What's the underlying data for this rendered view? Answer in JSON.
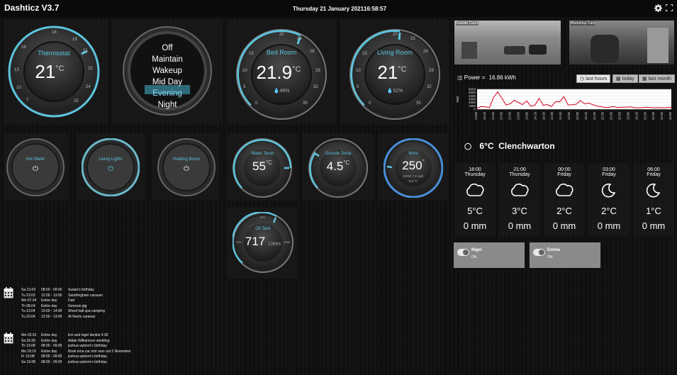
{
  "header": {
    "title": "Dashticz V3.7",
    "date": "Thursday 21 January 2021",
    "time": "16:58:57"
  },
  "thermostat": {
    "label": "Thermostat",
    "value": "21",
    "unit": "°C",
    "ticks": [
      "5",
      "7",
      "10",
      "13",
      "16",
      "18",
      "19",
      "20",
      "21",
      "22",
      "24",
      "25"
    ]
  },
  "mode_selector": {
    "items": [
      "Off",
      "Maintain",
      "Wakeup",
      "Mid Day",
      "Evening",
      "Night"
    ],
    "selected": "Evening"
  },
  "bedroom": {
    "label": "Bed Room",
    "value": "21.9",
    "unit": "°C",
    "humidity": "49%",
    "ticks": [
      "0",
      "5",
      "10",
      "15",
      "20",
      "23",
      "26",
      "29",
      "32",
      "35"
    ]
  },
  "livingroom": {
    "label": "Living Room",
    "value": "21",
    "unit": "°C",
    "humidity": "52%",
    "ticks": [
      "0",
      "5",
      "10",
      "15",
      "20",
      "23",
      "26",
      "29",
      "32",
      "35"
    ]
  },
  "switches": [
    {
      "label": "Hot Water"
    },
    {
      "label": "Living Lights"
    },
    {
      "label": "Heating Boost"
    }
  ],
  "water_temp": {
    "label": "Water Temp",
    "value": "55",
    "unit": "°C"
  },
  "outside_temp": {
    "label": "Outside Temp",
    "value": "4.5",
    "unit": "°C"
  },
  "wind": {
    "label": "Wind",
    "value": "250",
    "unit": "°",
    "sub1": "WSW",
    "sub2": "7.3 mph",
    "sub3": "5.8 °C"
  },
  "oil_tank": {
    "label": "Oil Tank",
    "value": "717",
    "unit": "Litres",
    "ticks": [
      "0",
      "125",
      "250",
      "375",
      "500",
      "625",
      "750",
      "875",
      "1000",
      "1125",
      "1250"
    ]
  },
  "cameras": [
    {
      "caption": "Outside Cam1"
    },
    {
      "caption": "Workshop Cam"
    }
  ],
  "power": {
    "label": "Power",
    "value": "16.86 kWh",
    "buttons": {
      "last_hours": "last hours",
      "today": "today",
      "last_month": "last month"
    },
    "ylabel": "Watt",
    "yticks": [
      "0",
      "1000",
      "2000",
      "3000",
      "4000",
      "5000",
      "6000"
    ],
    "xticks": [
      "13:00",
      "13:10",
      "13:20",
      "13:30",
      "13:40",
      "13:50",
      "14:00",
      "14:10",
      "14:20",
      "14:30",
      "14:40",
      "14:50",
      "15:00",
      "15:10",
      "15:20",
      "15:30",
      "15:40",
      "15:50",
      "16:00",
      "16:10",
      "16:20",
      "16:30",
      "16:40",
      "16:50"
    ]
  },
  "chart_data": {
    "type": "line",
    "title": "",
    "xlabel": "",
    "ylabel": "Watt",
    "ylim": [
      0,
      6000
    ],
    "x": [
      "13:00",
      "13:05",
      "13:10",
      "13:15",
      "13:20",
      "13:25",
      "13:30",
      "13:35",
      "13:40",
      "13:45",
      "13:50",
      "13:55",
      "14:00",
      "14:05",
      "14:10",
      "14:15",
      "14:20",
      "14:25",
      "14:30",
      "14:35",
      "14:40",
      "14:45",
      "14:50",
      "14:55",
      "15:00",
      "15:05",
      "15:10",
      "15:15",
      "15:20",
      "15:25",
      "15:30",
      "15:35",
      "15:40",
      "15:45",
      "15:50",
      "15:55",
      "16:00",
      "16:05",
      "16:10",
      "16:15",
      "16:20",
      "16:25",
      "16:30",
      "16:35",
      "16:40",
      "16:45",
      "16:50",
      "16:55"
    ],
    "series": [
      {
        "color": "#d0021b",
        "values": [
          300,
          800,
          700,
          500,
          3600,
          5200,
          3300,
          1300,
          1600,
          2700,
          2000,
          1400,
          2500,
          900,
          1200,
          3300,
          1200,
          1400,
          800,
          2300,
          2200,
          3800,
          1300,
          1300,
          1500,
          2600,
          1600,
          1800,
          1400,
          900,
          800,
          500,
          600,
          800,
          500,
          600,
          600,
          700,
          500,
          400,
          500,
          600,
          500,
          400,
          500,
          400,
          500,
          600
        ]
      }
    ]
  },
  "weather": {
    "current": "6°C  Clenchwarton",
    "forecast": [
      {
        "time": "18:00",
        "day": "Thursday",
        "icon": "cloud-icon",
        "temp": "5°C",
        "rain": "0 mm"
      },
      {
        "time": "21:00",
        "day": "Thursday",
        "icon": "cloud-icon",
        "temp": "3°C",
        "rain": "0 mm"
      },
      {
        "time": "00:00",
        "day": "Friday",
        "icon": "cloud-icon",
        "temp": "2°C",
        "rain": "0 mm"
      },
      {
        "time": "03:00",
        "day": "Friday",
        "icon": "moon-icon",
        "temp": "2°C",
        "rain": "0 mm"
      },
      {
        "time": "06:00",
        "day": "Friday",
        "icon": "moon-icon",
        "temp": "1°C",
        "rain": "0 mm"
      }
    ]
  },
  "presence": [
    {
      "name": "Nigel",
      "state": "ON"
    },
    {
      "name": "Emma",
      "state": "ON"
    }
  ],
  "calendar1": [
    [
      "Sa 13.03",
      "08:00 - 09:00",
      "Susan's birthday"
    ],
    [
      "Tu 23.03",
      "12:00 - 13:00",
      "Sandringham caravan"
    ],
    [
      "We 07.04",
      "Entire day",
      "Dad"
    ],
    [
      "Th 08.04",
      "Entire day",
      "Genesis gig"
    ],
    [
      "Tu 13.04",
      "13:00 - 14:00",
      "Wood hall spa camping"
    ],
    [
      "Tu 20.04",
      "12:00 - 13:00",
      "At Neots caravan"
    ]
  ],
  "calendar2": [
    [
      "We 03.03",
      "Entire day",
      "Em and nigel dentist 4.30"
    ],
    [
      "Sa 26.06",
      "Entire day",
      "Abbie Williamson wedding"
    ],
    [
      "Th 19.08",
      "08:00 - 09:00",
      "joshua wyborn's birthday"
    ],
    [
      "Mo 18.10",
      "Entire day",
      "Book ema car mot runs out 2 November"
    ],
    [
      "Fr 19.08",
      "08:00 - 09:00",
      "joshua wyborn's birthday"
    ],
    [
      "Sa 19.08",
      "08:00 - 09:00",
      "joshua wyborn's birthday"
    ]
  ]
}
